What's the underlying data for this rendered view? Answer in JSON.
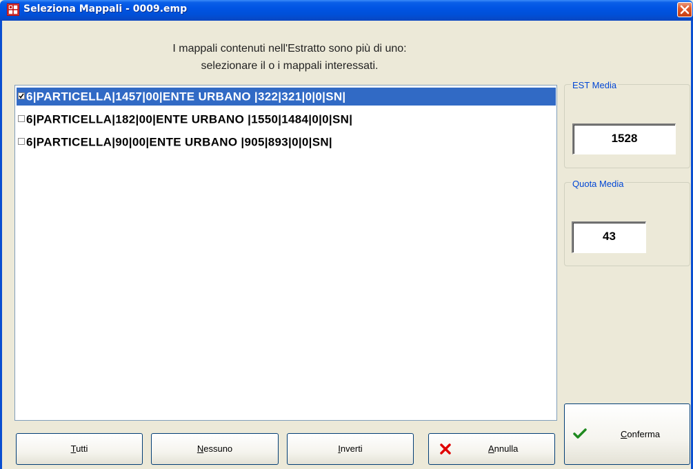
{
  "window": {
    "title": "Seleziona Mappali - 0009.emp"
  },
  "instructions": {
    "line1": "I mappali contenuti nell'Estratto sono più di uno:",
    "line2": "selezionare il o i mappali interessati."
  },
  "list": {
    "items": [
      {
        "text": "6|PARTICELLA|1457|00|ENTE URBANO |322|321|0|0|SN|",
        "checked": true,
        "selected": true
      },
      {
        "text": "6|PARTICELLA|182|00|ENTE URBANO |1550|1484|0|0|SN|",
        "checked": false,
        "selected": false
      },
      {
        "text": "6|PARTICELLA|90|00|ENTE URBANO |905|893|0|0|SN|",
        "checked": false,
        "selected": false
      }
    ]
  },
  "est_media": {
    "label": "EST Media",
    "value": "1528"
  },
  "quota_media": {
    "label": "Quota Media",
    "value": "43"
  },
  "buttons": {
    "tutti": {
      "mnemonic": "T",
      "rest": "utti"
    },
    "nessuno": {
      "mnemonic": "N",
      "rest": "essuno"
    },
    "inverti": {
      "mnemonic": "I",
      "rest": "nverti"
    },
    "annulla": {
      "mnemonic": "A",
      "rest": "nnulla"
    },
    "conferma": {
      "mnemonic": "C",
      "rest": "onferma"
    }
  },
  "colors": {
    "selection": "#316ac5",
    "titlebar": "#0054e3",
    "group_label": "#0046d5",
    "close_button": "#e0572a",
    "cancel_icon": "#e00000",
    "confirm_icon": "#1f8a1f"
  },
  "icons": {
    "app": "grid-app-icon",
    "close": "close-icon",
    "cancel": "x-icon",
    "confirm": "checkmark-icon"
  }
}
